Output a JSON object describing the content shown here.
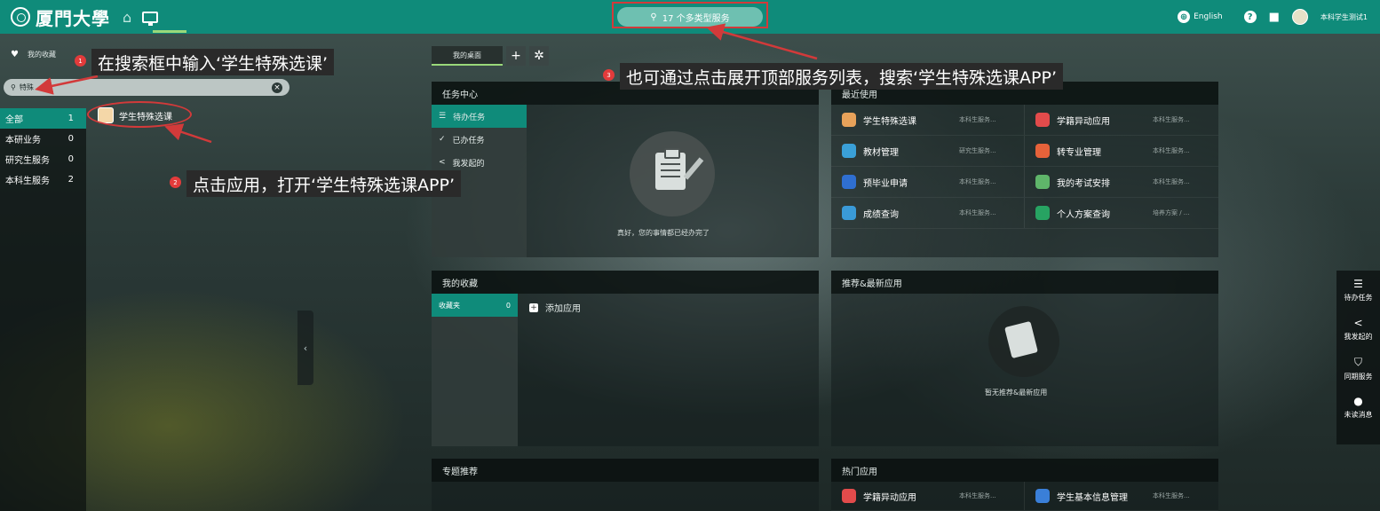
{
  "topbar": {
    "logo_text": "厦門大學",
    "service_search_label": "17 个多类型服务",
    "language": "English",
    "user_name": "本科学生测试1"
  },
  "left_panel": {
    "favorites_label": "我的收藏",
    "search_value": "特殊",
    "categories": [
      {
        "label": "全部",
        "count": "1"
      },
      {
        "label": "本研业务",
        "count": "0"
      },
      {
        "label": "研究生服务",
        "count": "0"
      },
      {
        "label": "本科生服务",
        "count": "2"
      }
    ],
    "result_app": "学生特殊选课"
  },
  "callouts": {
    "step1": {
      "number": "1",
      "text": "在搜索框中输入‘学生特殊选课’"
    },
    "step2": {
      "number": "2",
      "text": "点击应用，打开‘学生特殊选课APP’"
    },
    "step3": {
      "number": "3",
      "text": "也可通过点击展开顶部服务列表，搜索‘学生特殊选课APP’"
    }
  },
  "desk": {
    "tab_label": "我的桌面"
  },
  "task_center": {
    "title": "任务中心",
    "items": [
      "待办任务",
      "已办任务",
      "我发起的"
    ],
    "empty_text": "真好，您的事情都已经办完了"
  },
  "recent": {
    "title": "最近使用",
    "rows": [
      [
        {
          "name": "学生特殊选课",
          "cat": "本科生服务...",
          "color": "#e8a25a"
        },
        {
          "name": "学籍异动应用",
          "cat": "本科生服务...",
          "color": "#e24b4b"
        }
      ],
      [
        {
          "name": "教材管理",
          "cat": "研究生服务...",
          "color": "#3aa0d8"
        },
        {
          "name": "转专业管理",
          "cat": "本科生服务...",
          "color": "#e6623a"
        }
      ],
      [
        {
          "name": "预毕业申请",
          "cat": "本科生服务...",
          "color": "#2f6fd1"
        },
        {
          "name": "我的考试安排",
          "cat": "本科生服务...",
          "color": "#5fb56a"
        }
      ],
      [
        {
          "name": "成绩查询",
          "cat": "本科生服务...",
          "color": "#3a9ad8"
        },
        {
          "name": "个人方案查询",
          "cat": "培养方案 / ...",
          "color": "#27a362"
        }
      ]
    ]
  },
  "favorites": {
    "title": "我的收藏",
    "folder_label": "收藏夹",
    "folder_count": "0",
    "add_label": "添加应用"
  },
  "recommend": {
    "title": "推荐&最新应用",
    "empty_text": "暂无推荐&最新应用"
  },
  "topics": {
    "title": "专题推荐"
  },
  "hot": {
    "title": "热门应用",
    "items": [
      {
        "name": "学籍异动应用",
        "cat": "本科生服务...",
        "color": "#e24b4b"
      },
      {
        "name": "学生基本信息管理",
        "cat": "本科生服务...",
        "color": "#3a7fd8"
      }
    ]
  },
  "rail": {
    "items": [
      {
        "label": "待办任务",
        "icon": "list-icon"
      },
      {
        "label": "我发起的",
        "icon": "share-icon"
      },
      {
        "label": "同期服务",
        "icon": "shield-icon"
      },
      {
        "label": "未读消息",
        "icon": "chat-icon"
      }
    ]
  },
  "colors": {
    "brand": "#0f8b7a",
    "annotation_red": "#d23a3a",
    "accent_green": "#9ad87a"
  }
}
